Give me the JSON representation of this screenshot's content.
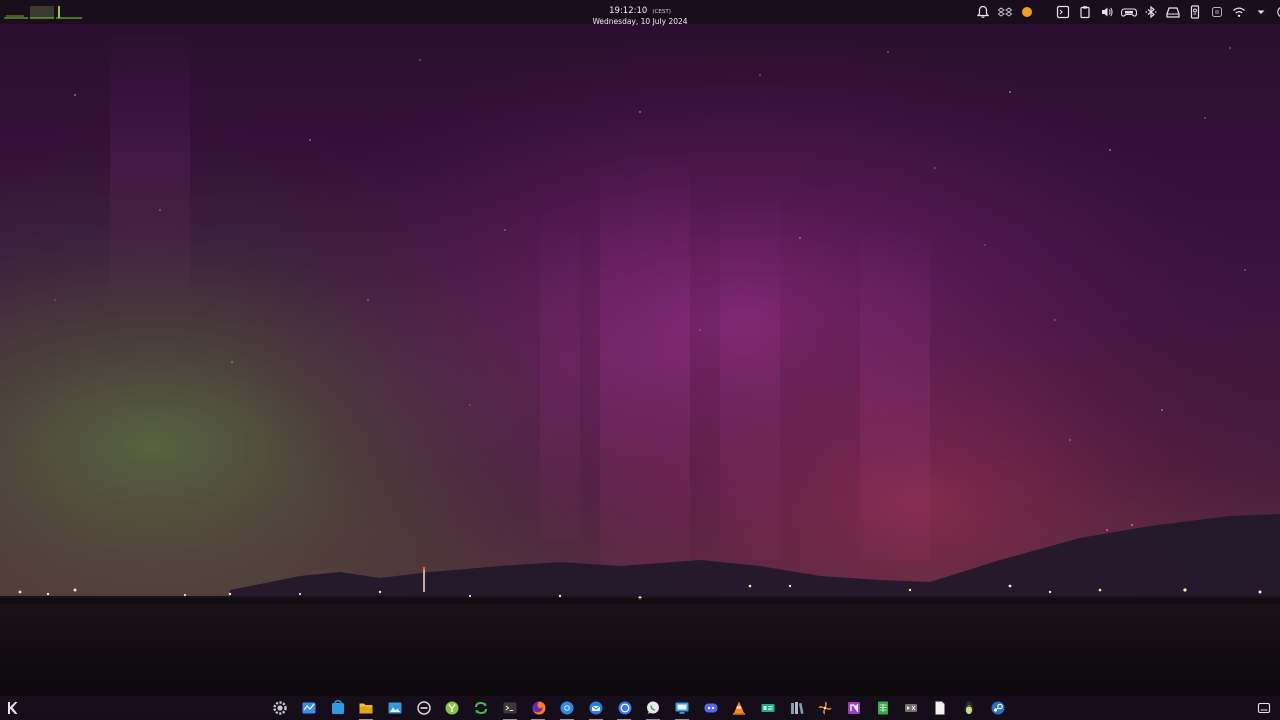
{
  "top_panel": {
    "clock": {
      "time": "19:12:10",
      "timezone": "(CEST)",
      "date": "Wednesday, 10 July 2024"
    },
    "system_monitor": {
      "icon": "system-monitor-graph-icon",
      "color": "#8ecf3a"
    },
    "tray_left": [
      {
        "name": "notifications-bell-icon"
      },
      {
        "name": "dropbox-icon"
      },
      {
        "name": "status-orange-dot-icon",
        "color": "#f0a020"
      }
    ],
    "tray_right": [
      {
        "name": "terminal-dropdown-icon"
      },
      {
        "name": "clipboard-icon"
      },
      {
        "name": "volume-icon"
      },
      {
        "name": "gamepad-battery-icon"
      },
      {
        "name": "bluetooth-icon"
      },
      {
        "name": "disks-devices-icon"
      },
      {
        "name": "phone-connect-icon"
      },
      {
        "name": "display-config-icon"
      },
      {
        "name": "wifi-icon"
      },
      {
        "name": "tray-expand-chevron-icon"
      },
      {
        "name": "power-session-icon"
      }
    ]
  },
  "dock": {
    "launcher": {
      "name": "kde-launcher-icon"
    },
    "apps": [
      {
        "name": "system-settings-icon",
        "color": "#c8c8cc"
      },
      {
        "name": "system-monitor-app-icon",
        "color": "#3d8ee8"
      },
      {
        "name": "discover-store-icon",
        "color": "#2f9be0"
      },
      {
        "name": "file-manager-folder-icon",
        "color": "#f2c12e"
      },
      {
        "name": "image-viewer-icon",
        "color": "#3a9ad9"
      },
      {
        "name": "minus-circle-app-icon",
        "color": "#e0e0e0"
      },
      {
        "name": "yakuake-app-icon",
        "color": "#8bc34a"
      },
      {
        "name": "sync-app-icon",
        "color": "#3fbf4a"
      },
      {
        "name": "terminal-app-icon",
        "color": "#3a3a3a"
      },
      {
        "name": "firefox-icon",
        "color": "#ff7b20"
      },
      {
        "name": "chromium-browser-icon",
        "color": "#2d8ce6"
      },
      {
        "name": "thunderbird-mail-icon",
        "color": "#2b7fd6"
      },
      {
        "name": "signal-messenger-icon",
        "color": "#3a76f0"
      },
      {
        "name": "whatsapp-icon",
        "color": "#e8e8e8"
      },
      {
        "name": "remote-desktop-icon",
        "color": "#2fa3e6"
      },
      {
        "name": "discord-icon",
        "color": "#5865f2"
      },
      {
        "name": "vlc-player-icon",
        "color": "#f28a1a"
      },
      {
        "name": "network-card-app-icon",
        "color": "#1fae8a"
      },
      {
        "name": "library-books-icon",
        "color": "#8a9bb0"
      },
      {
        "name": "pinwheel-app-icon",
        "color": "#e8742a"
      },
      {
        "name": "onenote-icon",
        "color": "#9b3fc4"
      },
      {
        "name": "spreadsheet-app-icon",
        "color": "#3aa845"
      },
      {
        "name": "video-editor-app-icon",
        "color": "#707070"
      },
      {
        "name": "text-document-icon",
        "color": "#f0f0f0"
      },
      {
        "name": "penguin-app-icon",
        "color": "#c8e08a"
      },
      {
        "name": "steam-icon",
        "color": "#2a6fc0"
      }
    ],
    "show_desktop": {
      "name": "show-desktop-icon"
    }
  },
  "wallpaper": {
    "name": "aurora-night-sky-wallpaper"
  }
}
